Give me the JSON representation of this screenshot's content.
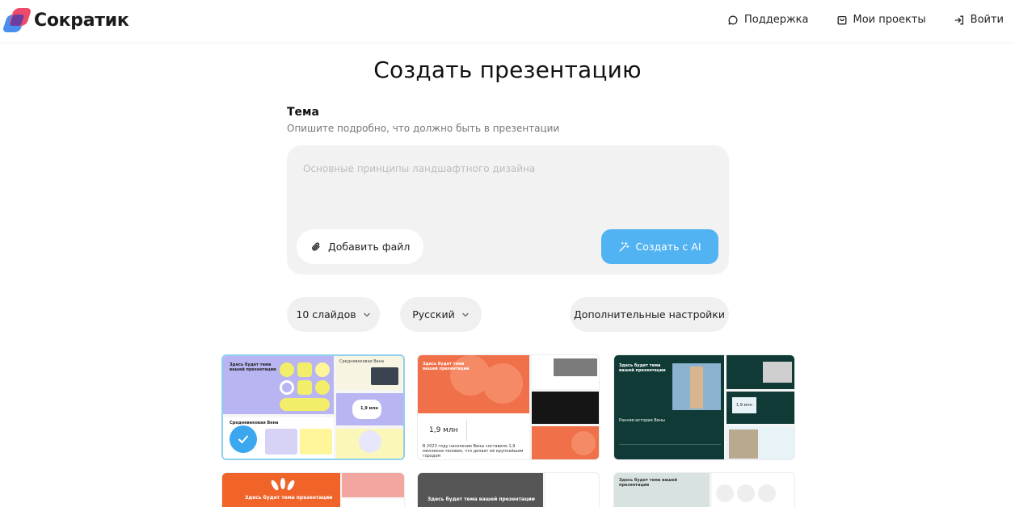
{
  "header": {
    "brand": "Сократик",
    "nav": {
      "support": "Поддержка",
      "projects": "Мои проекты",
      "login": "Войти"
    }
  },
  "page": {
    "title": "Создать презентацию"
  },
  "form": {
    "topic_label": "Тема",
    "topic_hint": "Опишите подробно, что должно быть в презентации",
    "topic_placeholder": "Основные принципы ландшафтного дизайна",
    "topic_value": "",
    "add_file_label": "Добавить файл",
    "create_label": "Создать с AI"
  },
  "options": {
    "slides_label": "10 слайдов",
    "language_label": "Русский",
    "settings_label": "Дополнительные настройки"
  },
  "templates": {
    "t1": {
      "heading": "Здесь будет тема вашей презентации",
      "caption": "Средневековая Вена",
      "stat": "1,9 млн"
    },
    "t2": {
      "heading": "Здесь будет тема вашей презентации",
      "stat": "1,9 млн",
      "caption": "В 2023 году население Вены составило 1,9 миллиона человек, что делает её крупнейшим городом"
    },
    "t3": {
      "heading": "Здесь будет тема вашей презентации",
      "caption": "Ранняя история Вены",
      "stat": "1,9 млн"
    },
    "t4": {
      "heading": "Здесь будет тема презентации"
    },
    "t5": {
      "heading": "Здесь будет тема вашей презентации"
    },
    "t6": {
      "heading": "Здесь будет тема вашей презентации"
    },
    "selected": "t1"
  },
  "colors": {
    "accent": "#52b3f2",
    "selected_border": "#8fd1ef",
    "field_bg": "#f2f2f2"
  }
}
